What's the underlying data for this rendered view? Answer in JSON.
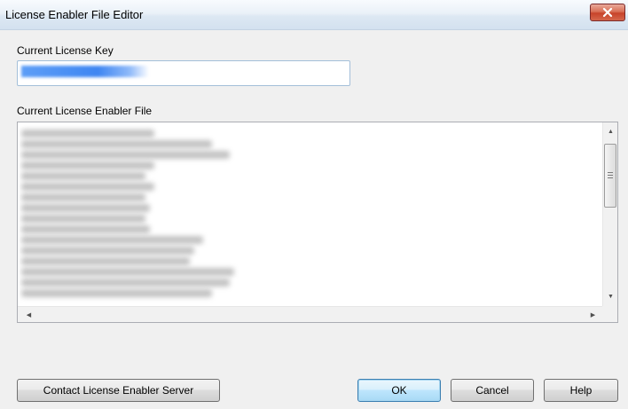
{
  "window": {
    "title": "License Enabler File Editor"
  },
  "license_key": {
    "label": "Current License Key",
    "value_redacted": true
  },
  "license_file": {
    "label": "Current License Enabler File",
    "content_redacted": true
  },
  "buttons": {
    "contact": "Contact License Enabler Server",
    "ok": "OK",
    "cancel": "Cancel",
    "help": "Help"
  },
  "colors": {
    "titlebar": "#dde8f3",
    "close_button": "#c7432a",
    "default_button_border": "#3c7fb1",
    "selection_highlight": "#3f86f2"
  },
  "icons": {
    "close": "close-icon",
    "scroll_up": "scroll-up-arrow-icon",
    "scroll_down": "scroll-down-arrow-icon",
    "scroll_left": "scroll-left-arrow-icon",
    "scroll_right": "scroll-right-arrow-icon"
  }
}
